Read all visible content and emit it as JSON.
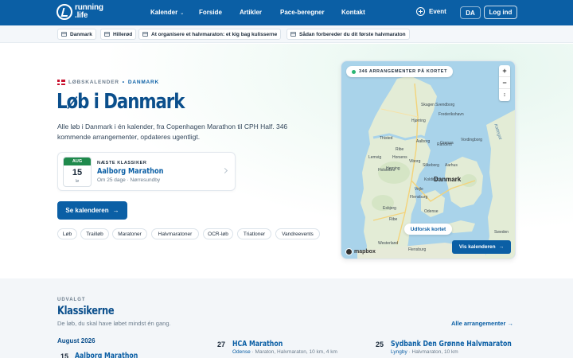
{
  "nav": {
    "logo_line1": "running",
    "logo_line2": ".life",
    "links": [
      "Kalender",
      "Forside",
      "Artikler",
      "Pace-beregner",
      "Kontakt"
    ],
    "event_label": "Event",
    "lang": "DA",
    "login_label": "Log ind"
  },
  "subnav": {
    "chips": [
      "Danmark",
      "Hillerød",
      "At organisere et halvmaraton: et kig bag kulisserne",
      "Sådan forbereder du dit første halvmaraton"
    ]
  },
  "hero": {
    "crumb_section": "LØBSKALENDER",
    "crumb_country": "DANMARK",
    "title": "Løb i Danmark",
    "lead": "Alle løb i Danmark i én kalender, fra Copenhagen Marathon til CPH Half. 346 kommende arrangementer, opdateres ugentligt.",
    "next_classic": {
      "month": "AUG",
      "day": "15",
      "weekday": "lø",
      "kicker": "NÆSTE KLASSIKER",
      "title": "Aalborg Marathon",
      "meta": "Om 25 dage · Nørresundby"
    },
    "cta_label": "Se kalenderen",
    "tags": [
      "Løb",
      "Trailløb",
      "Maratoner",
      "Halvmaratoner",
      "OCR-løb",
      "Triatloner",
      "Vandreevents"
    ]
  },
  "map": {
    "count_label": "346 ARRANGEMENTER PÅ KORTET",
    "zoom_in": "+",
    "zoom_out": "−",
    "reset": "↕",
    "explore_label": "Udforsk kortet",
    "view_calendar_label": "Vis kalenderen",
    "attribution": "mapbox",
    "country_label": "Danmark",
    "place_labels": [
      "Aalborg",
      "Randers",
      "Silkeborg",
      "Aarhus",
      "Herning",
      "Vejle",
      "Esbjerg",
      "Odense",
      "Kattegat",
      "Sweden",
      "Flensburg",
      "Westerland",
      "Skagen",
      "Lemvig",
      "Viborg",
      "Kolding",
      "Horsens",
      "Holstebro",
      "Thisted",
      "Ribe",
      "Svendborg",
      "Frederikshavn",
      "Hjørring",
      "Grenaa",
      "Skive",
      "Vordingborg"
    ],
    "road_badges": [
      "E45",
      "E39",
      "E20",
      "E45",
      "E45",
      "E20",
      "E20"
    ]
  },
  "classics": {
    "kicker": "UDVALGT",
    "title": "Klassikerne",
    "subtitle": "De løb, du skal have løbet mindst én gang.",
    "all_link": "Alle arrangementer →",
    "month": "August 2026",
    "events": [
      {
        "day": "15",
        "title": "Aalborg Marathon",
        "city": "",
        "meta": ""
      },
      {
        "day": "27",
        "title": "HCA Marathon",
        "city": "Odense",
        "meta": " · Maraton, Halvmaraton, 10 km, 4 km"
      },
      {
        "day": "25",
        "title": "Sydbank Den Grønne Halvmaraton",
        "city": "Lyngby",
        "meta": " · Halvmaraton, 10 km"
      }
    ]
  },
  "colors": {
    "brand_blue": "#0b5fa5",
    "accent_green": "#1f8a4c",
    "flag_red": "#c8102e"
  }
}
